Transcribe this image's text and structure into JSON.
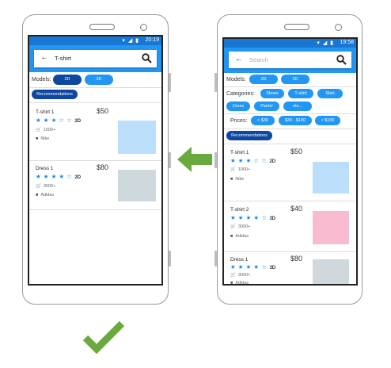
{
  "colors": {
    "accent": "#2196f3",
    "dark_accent": "#0d47a1",
    "arrow": "#6aaa3c",
    "check": "#6aaa3c"
  },
  "before": {
    "status_time": "20:19",
    "search_query": "T-shirt",
    "models_label": "Models:",
    "models": [
      "2D",
      "3D"
    ],
    "rec_label": "Recommendations",
    "items": [
      {
        "title": "T-shirt 1",
        "price": "$50",
        "stars": "★ ★ ★ ☆ ☆",
        "rating": "2D",
        "count": "1000+",
        "brand": "Nike",
        "thumb_color": "#bbdefb"
      },
      {
        "title": "Dress 1",
        "price": "$80",
        "stars": "★ ★ ★ ★ ☆",
        "rating": "2D",
        "count": "3000+",
        "brand": "Adidas",
        "thumb_color": "#cfd8dc"
      }
    ]
  },
  "after": {
    "status_time": "19:58",
    "search_placeholder": "Search",
    "models_label": "Models:",
    "models": [
      "2D",
      "3D"
    ],
    "categories_label": "Categories:",
    "categories": [
      "Shoes",
      "T-shirt",
      "Shirt",
      "Dress",
      "Pants!",
      "etc..."
    ],
    "prices_label": "Prices:",
    "prices": [
      "< $30",
      "$30 - $100",
      "> $100"
    ],
    "rec_label": "Recommendations",
    "items": [
      {
        "title": "T-shirt 1",
        "price": "$50",
        "stars": "★ ★ ★ ☆ ☆",
        "rating": "2D",
        "count": "1000+",
        "brand": "Nike",
        "thumb_color": "#bbdefb"
      },
      {
        "title": "T-shirt 2",
        "price": "$40",
        "stars": "★ ★ ★ ★ ☆",
        "rating": "3D",
        "count": "3000+",
        "brand": "Adidas",
        "thumb_color": "#f8bbd0"
      },
      {
        "title": "Dress 1",
        "price": "$80",
        "stars": "★ ★ ★ ★ ☆",
        "rating": "3D",
        "count": "3000+",
        "brand": "Adidas",
        "thumb_color": "#cfd8dc"
      }
    ]
  }
}
